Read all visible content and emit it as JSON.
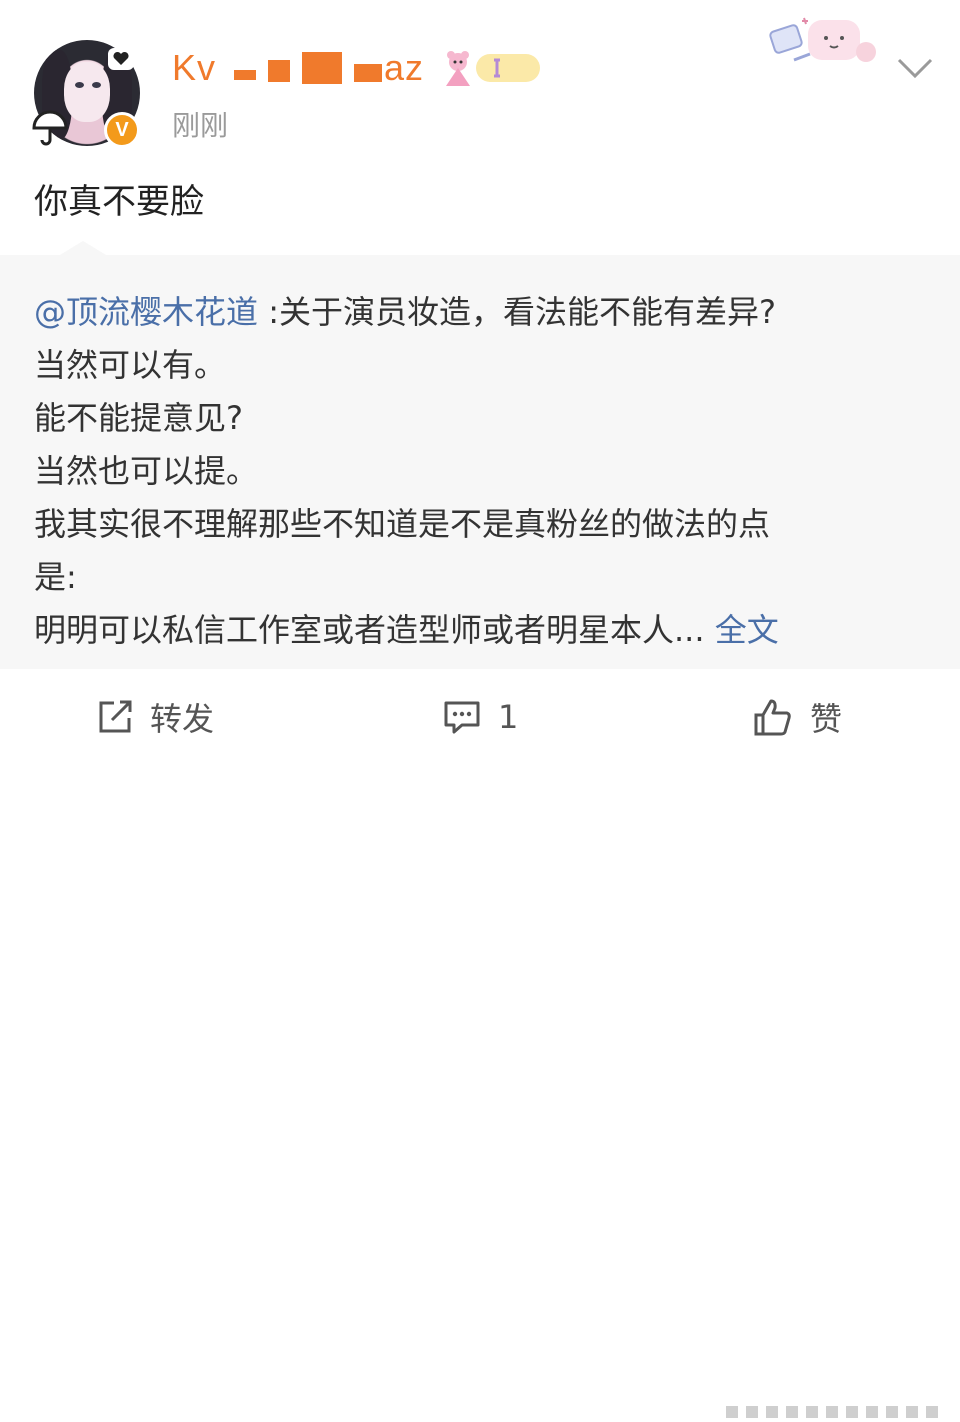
{
  "user": {
    "name_visible_start": "Kv",
    "name_visible_end": "az",
    "timestamp": "刚刚",
    "verified_badge": "V"
  },
  "post": {
    "text": "你真不要脸"
  },
  "repost": {
    "mention": "@顶流樱木花道",
    "lines": [
      " :关于演员妆造，看法能不能有差异?",
      "当然可以有。",
      "能不能提意见?",
      "当然也可以提。",
      "我其实很不理解那些不知道是不是真粉丝的做法的点",
      "是:",
      "明明可以私信工作室或者造型师或者明星本人... "
    ],
    "full_text_link": "全文"
  },
  "actions": {
    "repost_label": "转发",
    "comment_count": "1",
    "like_label": "赞"
  },
  "colors": {
    "username": "#f07a2c",
    "link": "#4a6fa8",
    "badge": "#f39a1b",
    "repost_bg": "#f7f7f7"
  },
  "icons": [
    "umbrella-icon",
    "heart-dot-icon",
    "verified-badge",
    "user-tag-icon",
    "deco-sticker-icon",
    "chevron-down-icon",
    "repost-icon",
    "comment-icon",
    "like-icon"
  ]
}
